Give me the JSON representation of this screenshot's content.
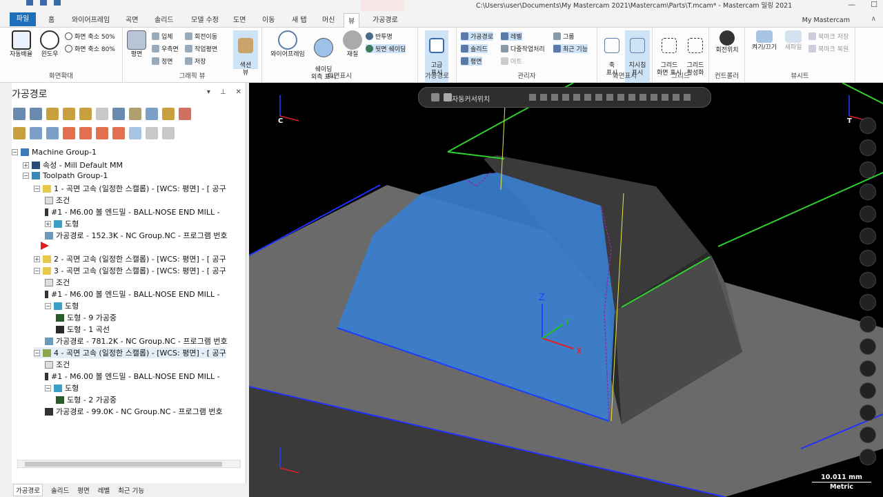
{
  "window": {
    "title": "C:\\Users\\user\\Documents\\My Mastercam 2021\\Mastercam\\Parts\\T.mcam* - Mastercam 밀링 2021",
    "context_label": "밀링",
    "minimize": "—",
    "maximize": "☐"
  },
  "tabs": {
    "file": "파일",
    "home": "홈",
    "wireframe": "와이어프레임",
    "surfaces": "곡면",
    "solids": "솔리드",
    "model_prep": "모델 수정",
    "drafting": "도면",
    "transform": "이동",
    "new_tab": "새 탭",
    "machine": "머신",
    "view": "뷰",
    "toolpaths": "가공경로",
    "my_mastercam": "My Mastercam",
    "collapse": "∧"
  },
  "ribbon": {
    "zoom": {
      "fit": "자동배율",
      "window": "윈도우",
      "unzoom50": "화면 축소 50%",
      "unzoom80": "화면 축소 80%",
      "label": "화면확대"
    },
    "graphics_view": {
      "top": "평면",
      "iso": "입체",
      "right": "우측면",
      "front": "정면",
      "rotate": "회전이동",
      "to_plane": "작업평면",
      "save": "저장",
      "color_view": "색션\n뷰",
      "label": "그래픽 뷰"
    },
    "display": {
      "wireframe": "와이어프레임",
      "shade_outline": "쉐이딩\n외측 표시",
      "material": "재질",
      "translucency": "반투명",
      "backface": "뒷면 쉐이딩",
      "label": "화면표시"
    },
    "toolpaths": {
      "advanced": "고급\n표시",
      "label": "가공경로"
    },
    "managers": {
      "toolpaths": "가공경로",
      "levels": "레벨",
      "groups": "그룹",
      "solids": "솔리드",
      "multi_threading": "다중작업처리",
      "recent": "최근 기능",
      "planes": "평면",
      "art": "아트",
      "label": "관리자"
    },
    "screen": {
      "axes": "축\n표시",
      "gnomons": "지시침\n표시",
      "label": "화면표시"
    },
    "grid": {
      "show": "그리드\n화면 표시",
      "snap": "그리드\n활성화",
      "label": "그리드"
    },
    "controller": {
      "home": "회전위치",
      "label": "컨트롤러"
    },
    "viewsheets": {
      "on_off": "켜기/끄기",
      "new": "새파일",
      "bookmark_save": "북마크 저장",
      "bookmark_restore": "북마크 복원",
      "label": "뷰시트"
    }
  },
  "panel": {
    "title": "가공경로",
    "pin": "▾",
    "autohide": "⊥",
    "close": "✕",
    "tree": [
      {
        "text": "Machine Group-1"
      },
      {
        "text": "속성 - Mill Default MM"
      },
      {
        "text": "Toolpath Group-1"
      },
      {
        "text": "1 - 곡면 고속 (일정한 스캘롭) - [WCS: 평면] - [  공구"
      },
      {
        "text": "조건"
      },
      {
        "text": "#1 - M6.00 볼 엔드밀 - BALL-NOSE END MILL -"
      },
      {
        "text": "도형"
      },
      {
        "text": "가공경로 - 152.3K - NC Group.NC - 프로그램 번호"
      },
      {
        "text": ""
      },
      {
        "text": "2 - 곡면 고속 (일정한 스캘롭) - [WCS: 평면] - [  공구"
      },
      {
        "text": "3 - 곡면 고속 (일정한 스캘롭) - [WCS: 평면] - [  공구"
      },
      {
        "text": "조건"
      },
      {
        "text": "#1 - M6.00 볼 엔드밀 - BALL-NOSE END MILL -"
      },
      {
        "text": "도형"
      },
      {
        "text": "도형 - 9 가공중"
      },
      {
        "text": "도형 - 1 곡선"
      },
      {
        "text": "가공경로 - 781.2K - NC Group.NC - 프로그램 번호"
      },
      {
        "text": "4 - 곡면 고속 (일정한 스캘롭) - [WCS: 평면] - [  공구"
      },
      {
        "text": "조건"
      },
      {
        "text": "#1 - M6.00 볼 엔드밀 - BALL-NOSE END MILL -"
      },
      {
        "text": "도형"
      },
      {
        "text": "도형 - 2 가공중"
      },
      {
        "text": "가공경로 - 99.0K - NC Group.NC - 프로그램 번호"
      }
    ],
    "bottom_tabs": [
      "가공경로",
      "솔리드",
      "평면",
      "레벨",
      "최근 기능"
    ]
  },
  "viewport": {
    "toolbar_label": "자동커서위치",
    "axis_c": "C",
    "axis_t": "T",
    "gnomon_x": "X",
    "gnomon_y": "Y",
    "gnomon_z": "Z",
    "scale_value": "10.011 mm",
    "scale_unit": "Metric"
  }
}
